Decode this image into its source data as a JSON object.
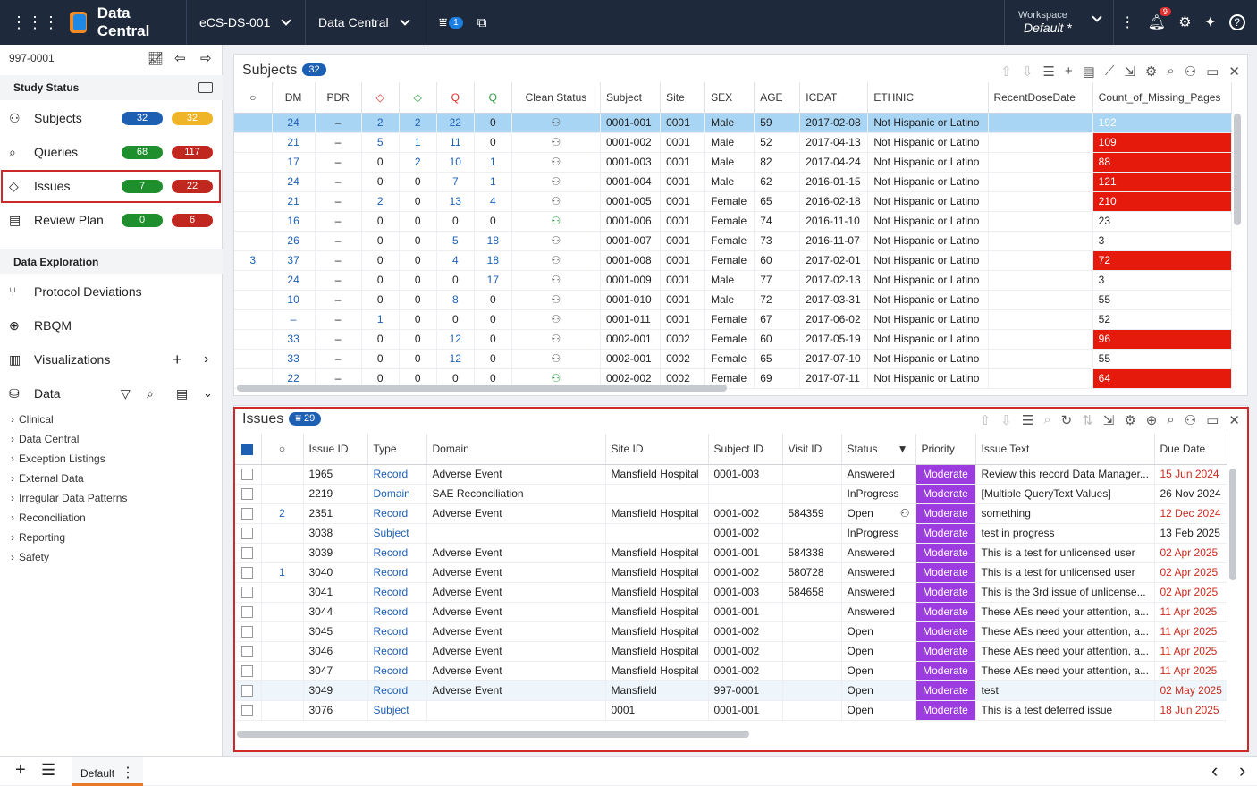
{
  "app": {
    "name": "Data Central",
    "study": "eCS-DS-001",
    "module": "Data Central",
    "filter_badge": "1",
    "workspace_label": "Workspace",
    "workspace_value": "Default",
    "workspace_mark": "*",
    "notif_count": "9"
  },
  "sidebar": {
    "subject_code": "997-0001",
    "study_status": "Study Status",
    "items": [
      {
        "label": "Subjects",
        "a": "32",
        "b": "32",
        "ca": "#1d5fb3",
        "cb": "#f0b429"
      },
      {
        "label": "Queries",
        "a": "68",
        "b": "117",
        "ca": "#1f8f2e",
        "cb": "#c0281f"
      },
      {
        "label": "Issues",
        "a": "7",
        "b": "22",
        "ca": "#1f8f2e",
        "cb": "#c0281f"
      },
      {
        "label": "Review Plan",
        "a": "0",
        "b": "6",
        "ca": "#1f8f2e",
        "cb": "#c0281f"
      }
    ],
    "data_exploration": "Data Exploration",
    "explore": [
      "Protocol Deviations",
      "RBQM",
      "Visualizations",
      "Data"
    ],
    "tree": [
      "Clinical",
      "Data Central",
      "Exception Listings",
      "External Data",
      "Irregular Data Patterns",
      "Reconciliation",
      "Reporting",
      "Safety"
    ]
  },
  "subjects": {
    "title": "Subjects",
    "count": "32",
    "headers": [
      "",
      "DM",
      "PDR",
      "",
      "",
      "",
      "",
      "Clean Status",
      "Subject",
      "Site",
      "SEX",
      "AGE",
      "ICDAT",
      "ETHNIC",
      "RecentDoseDate",
      "Count_of_Missing_Pages"
    ],
    "rows": [
      [
        "",
        "24",
        "–",
        "2",
        "2",
        "22",
        "0",
        "0001-001",
        "0001",
        "Male",
        "59",
        "2017-02-08",
        "Not Hispanic or Latino",
        "",
        "192"
      ],
      [
        "",
        "21",
        "–",
        "5",
        "1",
        "11",
        "0",
        "0001-002",
        "0001",
        "Male",
        "52",
        "2017-04-13",
        "Not Hispanic or Latino",
        "",
        "109"
      ],
      [
        "",
        "17",
        "–",
        "0",
        "2",
        "10",
        "1",
        "0001-003",
        "0001",
        "Male",
        "82",
        "2017-04-24",
        "Not Hispanic or Latino",
        "",
        "88"
      ],
      [
        "",
        "24",
        "–",
        "0",
        "0",
        "7",
        "1",
        "0001-004",
        "0001",
        "Male",
        "62",
        "2016-01-15",
        "Not Hispanic or Latino",
        "",
        "121"
      ],
      [
        "",
        "21",
        "–",
        "2",
        "0",
        "13",
        "4",
        "0001-005",
        "0001",
        "Female",
        "65",
        "2016-02-18",
        "Not Hispanic or Latino",
        "",
        "210"
      ],
      [
        "",
        "16",
        "–",
        "0",
        "0",
        "0",
        "0",
        "0001-006",
        "0001",
        "Female",
        "74",
        "2016-11-10",
        "Not Hispanic or Latino",
        "",
        "23"
      ],
      [
        "",
        "26",
        "–",
        "0",
        "0",
        "5",
        "18",
        "0001-007",
        "0001",
        "Female",
        "73",
        "2016-11-07",
        "Not Hispanic or Latino",
        "",
        "3"
      ],
      [
        "3",
        "37",
        "–",
        "0",
        "0",
        "4",
        "18",
        "0001-008",
        "0001",
        "Female",
        "60",
        "2017-02-01",
        "Not Hispanic or Latino",
        "",
        "72"
      ],
      [
        "",
        "24",
        "–",
        "0",
        "0",
        "0",
        "17",
        "0001-009",
        "0001",
        "Male",
        "77",
        "2017-02-13",
        "Not Hispanic or Latino",
        "",
        "3"
      ],
      [
        "",
        "10",
        "–",
        "0",
        "0",
        "8",
        "0",
        "0001-010",
        "0001",
        "Male",
        "72",
        "2017-03-31",
        "Not Hispanic or Latino",
        "",
        "55"
      ],
      [
        "",
        "–",
        "–",
        "1",
        "0",
        "0",
        "0",
        "0001-011",
        "0001",
        "Female",
        "67",
        "2017-06-02",
        "Not Hispanic or Latino",
        "",
        "52"
      ],
      [
        "",
        "33",
        "–",
        "0",
        "0",
        "12",
        "0",
        "0002-001",
        "0002",
        "Female",
        "60",
        "2017-05-19",
        "Not Hispanic or Latino",
        "",
        "96"
      ],
      [
        "",
        "33",
        "–",
        "0",
        "0",
        "12",
        "0",
        "0002-001",
        "0002",
        "Female",
        "65",
        "2017-07-10",
        "Not Hispanic or Latino",
        "",
        "55"
      ],
      [
        "",
        "22",
        "–",
        "0",
        "0",
        "0",
        "0",
        "0002-002",
        "0002",
        "Female",
        "69",
        "2017-07-11",
        "Not Hispanic or Latino",
        "",
        "64"
      ]
    ]
  },
  "issues": {
    "title": "Issues",
    "count": "29",
    "headers": [
      "",
      "",
      "Issue ID",
      "Type",
      "Domain",
      "Site ID",
      "Subject ID",
      "Visit ID",
      "Status",
      "Priority",
      "Issue Text",
      "Due Date"
    ],
    "rows": [
      [
        "",
        "1965",
        "Record",
        "Adverse Event",
        "Mansfield Hospital",
        "0001-003",
        "",
        "Answered",
        "Moderate",
        "Review this record Data Manager...",
        "15 Jun 2024"
      ],
      [
        "",
        "2219",
        "Domain",
        "SAE Reconciliation",
        "",
        "",
        "",
        "InProgress",
        "Moderate",
        "[Multiple QueryText Values]",
        "26 Nov 2024"
      ],
      [
        "2",
        "2351",
        "Record",
        "Adverse Event",
        "Mansfield Hospital",
        "0001-002",
        "584359",
        "Open",
        "Moderate",
        "something",
        "12 Dec 2024"
      ],
      [
        "",
        "3038",
        "Subject",
        "",
        "",
        "0001-002",
        "",
        "InProgress",
        "Moderate",
        "test in progress",
        "13 Feb 2025"
      ],
      [
        "",
        "3039",
        "Record",
        "Adverse Event",
        "Mansfield Hospital",
        "0001-001",
        "584338",
        "Answered",
        "Moderate",
        "This is a test for unlicensed user",
        "02 Apr 2025"
      ],
      [
        "1",
        "3040",
        "Record",
        "Adverse Event",
        "Mansfield Hospital",
        "0001-002",
        "580728",
        "Answered",
        "Moderate",
        "This is a test for unlicensed user",
        "02 Apr 2025"
      ],
      [
        "",
        "3041",
        "Record",
        "Adverse Event",
        "Mansfield Hospital",
        "0001-003",
        "584658",
        "Answered",
        "Moderate",
        "This is the 3rd issue of unlicense...",
        "02 Apr 2025"
      ],
      [
        "",
        "3044",
        "Record",
        "Adverse Event",
        "Mansfield Hospital",
        "0001-001",
        "",
        "Answered",
        "Moderate",
        "These AEs need your attention, a...",
        "11 Apr 2025"
      ],
      [
        "",
        "3045",
        "Record",
        "Adverse Event",
        "Mansfield Hospital",
        "0001-002",
        "",
        "Open",
        "Moderate",
        "These AEs need your attention, a...",
        "11 Apr 2025"
      ],
      [
        "",
        "3046",
        "Record",
        "Adverse Event",
        "Mansfield Hospital",
        "0001-002",
        "",
        "Open",
        "Moderate",
        "These AEs need your attention, a...",
        "11 Apr 2025"
      ],
      [
        "",
        "3047",
        "Record",
        "Adverse Event",
        "Mansfield Hospital",
        "0001-002",
        "",
        "Open",
        "Moderate",
        "These AEs need your attention, a...",
        "11 Apr 2025"
      ],
      [
        "",
        "3049",
        "Record",
        "Adverse Event",
        "Mansfield",
        "997-0001",
        "",
        "Open",
        "Moderate",
        "test",
        "02 May 2025"
      ],
      [
        "",
        "3076",
        "Subject",
        "",
        "0001",
        "0001-001",
        "",
        "Open",
        "Moderate",
        "This is a test deferred issue",
        "18 Jun 2025"
      ]
    ]
  },
  "bottom": {
    "tab": "Default"
  }
}
